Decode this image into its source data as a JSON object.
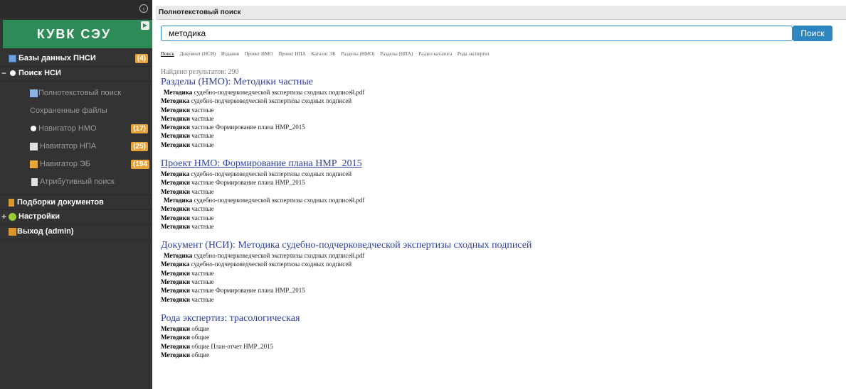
{
  "sidebar": {
    "brand": "КУВК СЭУ",
    "items": [
      {
        "label": "Базы данных ПНСИ",
        "badge": "(4)"
      },
      {
        "label": "Поиск НСИ",
        "toggle": "−"
      },
      {
        "label": "Полнотекстовый поиск"
      },
      {
        "label": "Сохраненные файлы"
      },
      {
        "label": "Навигатор НМО",
        "badge": "(17)"
      },
      {
        "label": "Навигатор НПА",
        "badge": "(25)"
      },
      {
        "label": "Навигатор ЭБ",
        "badge": "(194"
      },
      {
        "label": "Атрибутивный поиск"
      },
      {
        "label": "Подборки документов"
      },
      {
        "label": "Настройки",
        "toggle": "+"
      },
      {
        "label": "Выход (admin)"
      }
    ]
  },
  "header": {
    "title": "Полнотекстовый поиск"
  },
  "search": {
    "value": "методика",
    "button": "Поиск"
  },
  "tabs": [
    "Поиск",
    "Документ (НСИ)",
    "Издания",
    "Проект НМО",
    "Проект НПА",
    "Каталог ЭБ",
    "Разделы (НМО)",
    "Разделы (НПА)",
    "Раздел каталога",
    "Рода экспертиз"
  ],
  "results": {
    "found": "Найдено результатов: 290",
    "groups": [
      {
        "title": "Разделы (НМО):  Методики частные",
        "lines": [
          {
            "b": "Методика",
            "t": " судебно-подчерковедческой экспертизы сходных подписей.pdf"
          },
          {
            "b": "Методика",
            "t": " судебно-подчерковедческой экспертизы сходных подписей"
          },
          {
            "b": "Методики",
            "t": " частные"
          },
          {
            "b": "Методики",
            "t": " частные"
          },
          {
            "b": "Методики",
            "t": " частные Формирование плана НМР_2015"
          },
          {
            "b": "Методики",
            "t": " частные"
          },
          {
            "b": "Методики",
            "t": " частные"
          }
        ]
      },
      {
        "title": "Проект НМО:  Формирование плана НМР_2015",
        "lines": [
          {
            "b": "Методика",
            "t": " судебно-подчерковедческой экспертизы сходных подписей"
          },
          {
            "b": "Методики",
            "t": " частные Формирование плана НМР_2015"
          },
          {
            "b": "Методики",
            "t": " частные"
          },
          {
            "b": "Методика",
            "t": " судебно-подчерковедческой экспертизы сходных подписей.pdf"
          },
          {
            "b": "Методики",
            "t": " частные"
          },
          {
            "b": "Методики",
            "t": " частные"
          },
          {
            "b": "Методики",
            "t": " частные"
          }
        ]
      },
      {
        "title": "Документ (НСИ):  Методика судебно-подчерковедческой экспертизы сходных подписей",
        "lines": [
          {
            "b": "Методика",
            "t": " судебно-подчерковедческой экспертизы сходных подписей.pdf"
          },
          {
            "b": "Методика",
            "t": " судебно-подчерковедческой экспертизы сходных подписей"
          },
          {
            "b": "Методики",
            "t": " частные"
          },
          {
            "b": "Методики",
            "t": " частные"
          },
          {
            "b": "Методики",
            "t": " частные Формирование плана НМР_2015"
          },
          {
            "b": "Методики",
            "t": " частные"
          }
        ]
      },
      {
        "title": "Рода экспертиз:  трасологическая",
        "lines": [
          {
            "b": "Методики",
            "t": " общие"
          },
          {
            "b": "Методики",
            "t": " общие"
          },
          {
            "b": "Методики",
            "t": " общие План-отчет НМР_2015"
          },
          {
            "b": "Методики",
            "t": " общие"
          }
        ]
      }
    ]
  }
}
